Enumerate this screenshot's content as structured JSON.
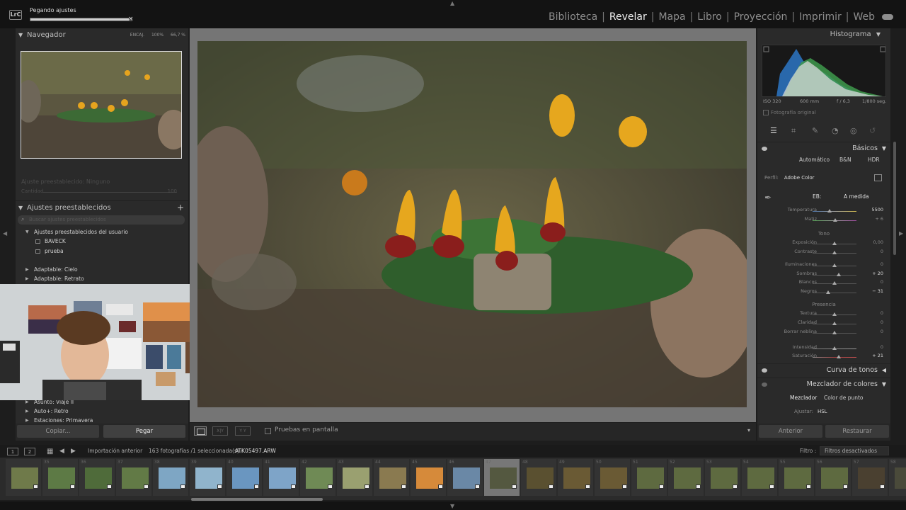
{
  "topbar": {
    "status": "Pegando ajustes",
    "progress": 0.97,
    "close": "×",
    "modules": [
      {
        "label": "Biblioteca",
        "active": false
      },
      {
        "label": "Revelar",
        "active": true
      },
      {
        "label": "Mapa",
        "active": false
      },
      {
        "label": "Libro",
        "active": false
      },
      {
        "label": "Proyección",
        "active": false
      },
      {
        "label": "Imprimir",
        "active": false
      },
      {
        "label": "Web",
        "active": false
      }
    ],
    "separator": "|",
    "logo": "LrC"
  },
  "left": {
    "navigator": {
      "title": "Navegador",
      "options": [
        "ENCAJ.",
        "100%",
        "66,7 %"
      ]
    },
    "faded_title": "Ajuste preestablecido: Ninguno",
    "faded_label": "Cantidad",
    "faded_value": "100",
    "presets": {
      "title": "Ajustes preestablecidos",
      "add": "+",
      "search_placeholder": "Buscar ajustes preestablecidos",
      "rows": [
        {
          "label": "Ajustes preestablecidos del usuario",
          "type": "group-open"
        },
        {
          "label": "BAVECK",
          "type": "item"
        },
        {
          "label": "prueba",
          "type": "item"
        },
        {
          "label": "Adaptable: Cielo",
          "type": "group"
        },
        {
          "label": "Adaptable: Retrato",
          "type": "group"
        }
      ],
      "rows_bottom": [
        {
          "label": "Asunto: Viaje II"
        },
        {
          "label": "Auto+: Retro"
        },
        {
          "label": "Estaciones: Primavera"
        }
      ]
    },
    "buttons": {
      "copy": "Copiar...",
      "paste": "Pegar"
    }
  },
  "toolbar": {
    "soft_proof_label": "Pruebas en pantalla",
    "compare_xy": "X|Y",
    "before_after": "Y Y",
    "dropdown": "▾"
  },
  "right": {
    "histogram": {
      "title": "Histograma",
      "meta": [
        "ISO 320",
        "600 mm",
        "f / 6,3",
        "1/800 seg."
      ],
      "original_photo": "Fotografía original"
    },
    "basics": {
      "title": "Básicos",
      "treatment": [
        "Automático",
        "B&N",
        "HDR"
      ],
      "profile_label": "Perfil:",
      "profile_value": "Adobe Color",
      "wb_label": "EB:",
      "wb_value": "A medida",
      "sliders_wb": [
        {
          "label": "Temperatura",
          "value": "5500",
          "pos": 0.38
        },
        {
          "label": "Matiz",
          "value": "+ 6",
          "pos": 0.52
        }
      ],
      "group_tone": "Tono",
      "sliders_tone": [
        {
          "label": "Exposición",
          "value": "0,00",
          "pos": 0.5
        },
        {
          "label": "Contraste",
          "value": "0",
          "pos": 0.5
        },
        {
          "label": "Iluminaciones",
          "value": "0",
          "pos": 0.5
        },
        {
          "label": "Sombras",
          "value": "+ 20",
          "pos": 0.6
        },
        {
          "label": "Blancos",
          "value": "0",
          "pos": 0.5
        },
        {
          "label": "Negros",
          "value": "− 31",
          "pos": 0.35
        }
      ],
      "group_presence": "Presencia",
      "sliders_presence": [
        {
          "label": "Textura",
          "value": "0",
          "pos": 0.5
        },
        {
          "label": "Claridad",
          "value": "0",
          "pos": 0.5
        },
        {
          "label": "Borrar neblina",
          "value": "0",
          "pos": 0.5
        },
        {
          "label": "Intensidad",
          "value": "0",
          "pos": 0.5
        },
        {
          "label": "Saturación",
          "value": "+ 21",
          "pos": 0.6
        }
      ]
    },
    "tone_curve": {
      "title": "Curva de tonos"
    },
    "color_mixer": {
      "title": "Mezclador de colores",
      "tabs": [
        "Mezclador",
        "Color de punto"
      ],
      "adjust_label": "Ajustar:",
      "adjust_value": "HSL"
    },
    "buttons": {
      "previous": "Anterior",
      "reset": "Restaurar"
    }
  },
  "filmstrip_bar": {
    "monitor1": "1",
    "monitor2": "2",
    "source": "Importación anterior",
    "count": "163 fotografías /1 seleccionada(s) /",
    "filename": "ATK05497.ARW",
    "filter_label": "Filtro :",
    "filter_value": "Filtros desactivados"
  },
  "filmstrip": {
    "numbers": [
      "",
      "35",
      "36",
      "37",
      "38",
      "39",
      "40",
      "41",
      "42",
      "43",
      "44",
      "45",
      "46",
      "47",
      "48",
      "49",
      "50",
      "51",
      "52",
      "53",
      "54",
      "55",
      "56",
      "57",
      "58"
    ],
    "selected_index": 13
  },
  "colors": {
    "accent_text": "#eeeeee",
    "panel_bg": "#2a2a2a",
    "center_bg": "#757575",
    "hist_blue": "#2a6db3",
    "hist_green": "#3e9a4c"
  }
}
